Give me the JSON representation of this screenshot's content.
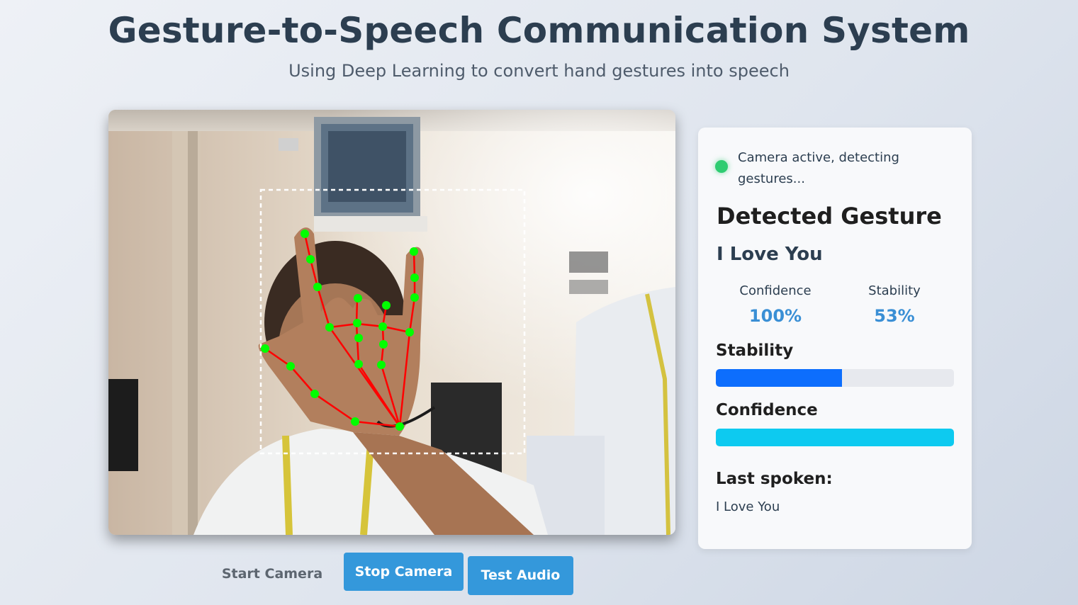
{
  "header": {
    "title": "Gesture-to-Speech Communication System",
    "subtitle": "Using Deep Learning to convert hand gestures into speech"
  },
  "status": {
    "text": "Camera active, detecting gestures...",
    "color": "#2ecc71"
  },
  "detection": {
    "heading": "Detected Gesture",
    "gesture": "I Love You",
    "confidence_label": "Confidence",
    "confidence_value": "100%",
    "stability_label": "Stability",
    "stability_value": "53%"
  },
  "bars": {
    "stability_label": "Stability",
    "stability_fraction": 0.53,
    "stability_color": "#0d6efd",
    "confidence_label": "Confidence",
    "confidence_fraction": 1.0,
    "confidence_color": "#0dcaf0"
  },
  "last_spoken": {
    "label": "Last spoken:",
    "value": "I Love You"
  },
  "buttons": {
    "start": "Start Camera",
    "stop": "Stop Camera",
    "audio": "Test Audio"
  },
  "colors": {
    "accent": "#3498db",
    "landmark": "#00ff00",
    "skeleton": "#ff0000"
  },
  "icons": {
    "status": "status-dot-icon"
  }
}
